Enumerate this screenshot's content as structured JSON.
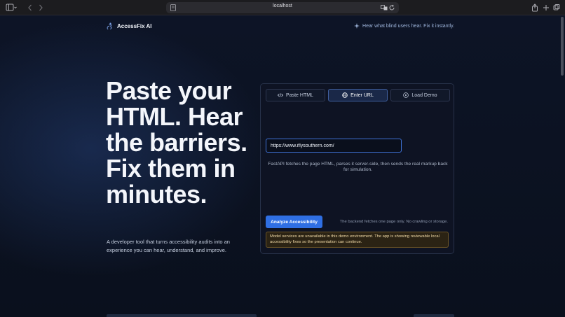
{
  "browser": {
    "url": "localhost"
  },
  "brand": {
    "name": "AccessFix AI",
    "tagline": "Hear what blind users hear. Fix it instantly."
  },
  "hero": {
    "headline": "Paste your HTML. Hear the barriers. Fix them in minutes.",
    "subtitle": "A developer tool that turns accessibility audits into an experience you can hear, understand, and improve."
  },
  "card": {
    "tabs": [
      {
        "label": "Paste HTML",
        "icon": "code-icon",
        "active": false
      },
      {
        "label": "Enter URL",
        "icon": "globe-icon",
        "active": true
      },
      {
        "label": "Load Demo",
        "icon": "play-icon",
        "active": false
      }
    ],
    "url_value": "https://www.iflysouthern.com/",
    "hint": "FastAPI fetches the page HTML, parses it server-side, then sends the real markup back for simulation.",
    "analyze_label": "Analyze Accessibility",
    "note": "The backend fetches one page only. No crawling or storage.",
    "warning": "Model services are unavailable in this demo environment. The app is showing reviewable local accessibility fixes so the presentation can continue."
  },
  "colors": {
    "accent": "#2f6fe3",
    "background": "#0b1120",
    "warning_bg": "#2b2314",
    "warning_text": "#f0d9a6"
  }
}
